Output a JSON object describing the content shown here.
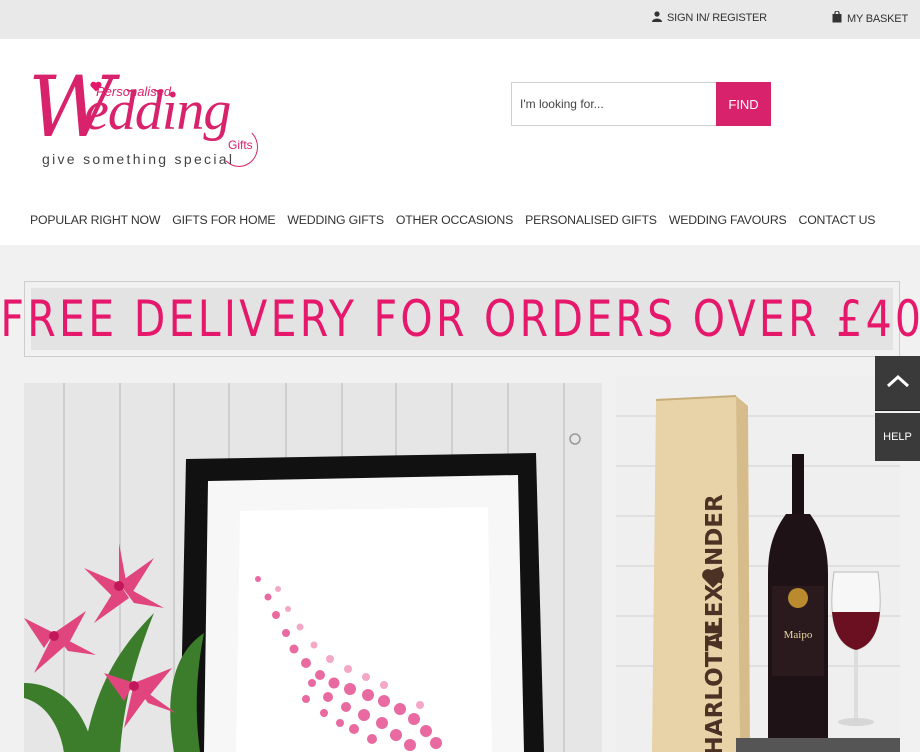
{
  "topbar": {
    "signin_label": "SIGN IN/ REGISTER",
    "basket_label": "MY BASKET"
  },
  "logo": {
    "line_personalised": "Personalised",
    "word_w": "W",
    "word_rest": "edding",
    "word_gifts": "Gifts",
    "tagline": "give something special"
  },
  "search": {
    "placeholder": "I'm looking for...",
    "button_label": "FIND"
  },
  "nav": {
    "items": [
      "POPULAR RIGHT NOW",
      "GIFTS FOR HOME",
      "WEDDING GIFTS",
      "OTHER OCCASIONS",
      "PERSONALISED GIFTS",
      "WEDDING FAVOURS",
      "CONTACT US"
    ]
  },
  "promo": {
    "text": "FREE DELIVERY FOR ORDERS OVER £40"
  },
  "hero_right": {
    "box_text_top": "ALEXANDER",
    "box_text_bottom": "CHARLOTTE",
    "bottle_brand": "Maipo"
  },
  "side_widget": {
    "help_label": "HELP"
  },
  "colors": {
    "brand_pink": "#d8226c",
    "promo_pink": "#e5186b",
    "topbar_bg": "#e9e9e9",
    "widget_dark": "#3a3a3a"
  },
  "icons": {
    "user": "user-icon",
    "basket": "basket-icon",
    "scroll_top": "chevron-up-icon",
    "heart": "heart-icon"
  }
}
